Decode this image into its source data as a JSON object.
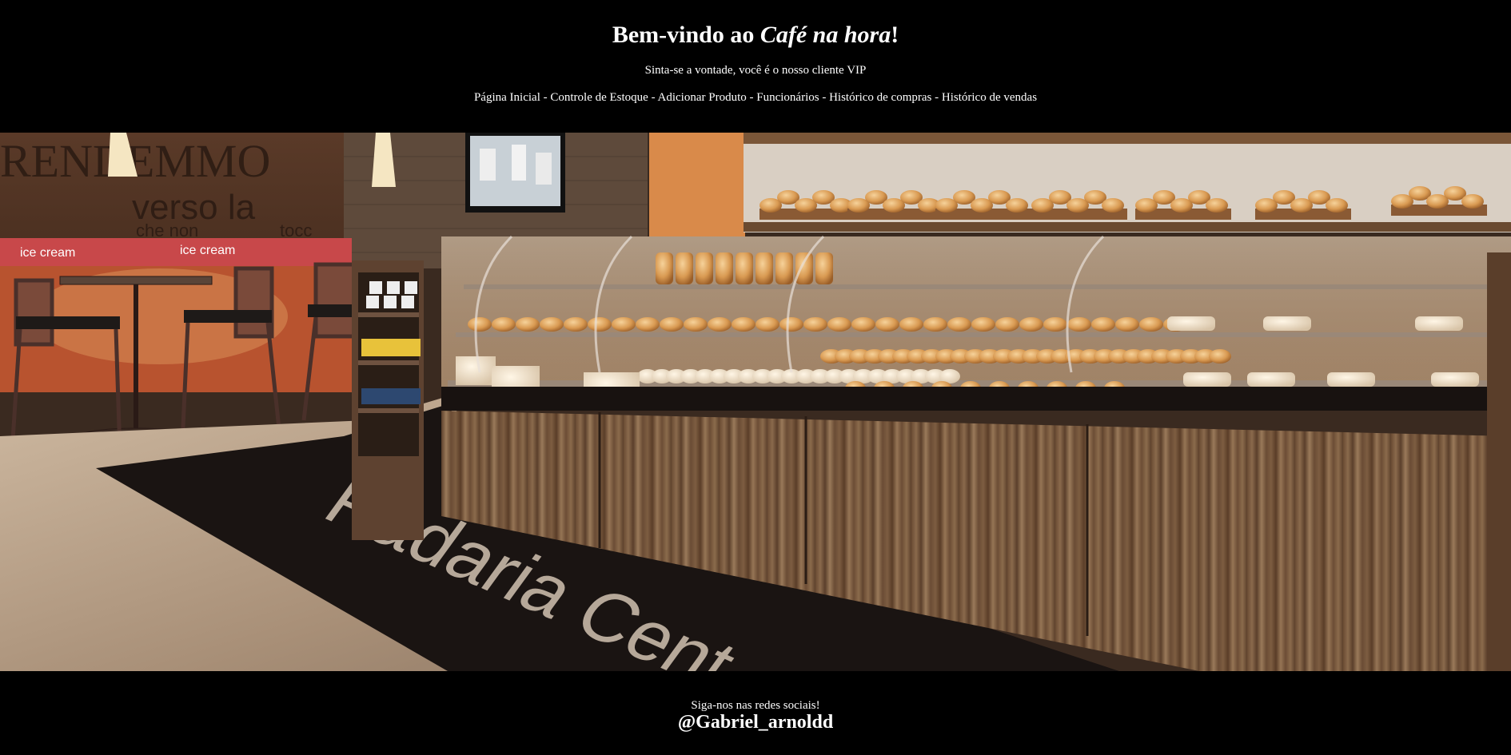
{
  "header": {
    "title_prefix": "Bem-vindo ao ",
    "title_brand": "Café na hora",
    "title_suffix": "!",
    "subtitle": "Sinta-se a vontade, você é o nosso cliente VIP"
  },
  "nav": {
    "separator": " - ",
    "items": [
      "Página Inicial",
      "Controle de Estoque",
      "Adicionar Produto",
      "Funcionários",
      "Histórico de compras",
      "Histórico de vendas"
    ]
  },
  "hero": {
    "wall_text_1": "RENDEMMO",
    "wall_text_2": "verso la",
    "wall_text_3": "che non",
    "wall_text_4": "tocc",
    "ice_cream_label": "ice cream",
    "floor_text": "Padaria Cent"
  },
  "footer": {
    "follow_text": "Siga-nos nas redes sociais!",
    "handle": "@Gabriel_arnoldd"
  }
}
